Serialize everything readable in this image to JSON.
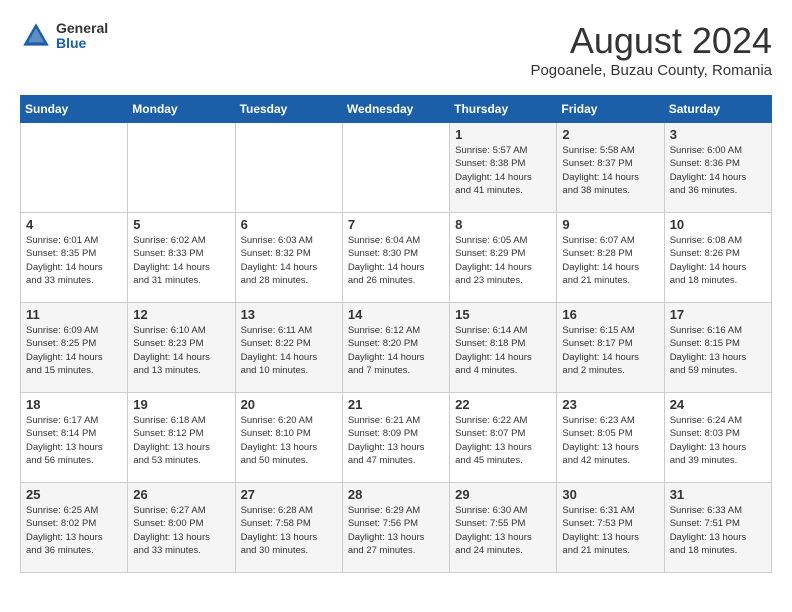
{
  "logo": {
    "general": "General",
    "blue": "Blue"
  },
  "title": "August 2024",
  "subtitle": "Pogoanele, Buzau County, Romania",
  "days_of_week": [
    "Sunday",
    "Monday",
    "Tuesday",
    "Wednesday",
    "Thursday",
    "Friday",
    "Saturday"
  ],
  "weeks": [
    [
      {
        "day": "",
        "info": ""
      },
      {
        "day": "",
        "info": ""
      },
      {
        "day": "",
        "info": ""
      },
      {
        "day": "",
        "info": ""
      },
      {
        "day": "1",
        "info": "Sunrise: 5:57 AM\nSunset: 8:38 PM\nDaylight: 14 hours\nand 41 minutes."
      },
      {
        "day": "2",
        "info": "Sunrise: 5:58 AM\nSunset: 8:37 PM\nDaylight: 14 hours\nand 38 minutes."
      },
      {
        "day": "3",
        "info": "Sunrise: 6:00 AM\nSunset: 8:36 PM\nDaylight: 14 hours\nand 36 minutes."
      }
    ],
    [
      {
        "day": "4",
        "info": "Sunrise: 6:01 AM\nSunset: 8:35 PM\nDaylight: 14 hours\nand 33 minutes."
      },
      {
        "day": "5",
        "info": "Sunrise: 6:02 AM\nSunset: 8:33 PM\nDaylight: 14 hours\nand 31 minutes."
      },
      {
        "day": "6",
        "info": "Sunrise: 6:03 AM\nSunset: 8:32 PM\nDaylight: 14 hours\nand 28 minutes."
      },
      {
        "day": "7",
        "info": "Sunrise: 6:04 AM\nSunset: 8:30 PM\nDaylight: 14 hours\nand 26 minutes."
      },
      {
        "day": "8",
        "info": "Sunrise: 6:05 AM\nSunset: 8:29 PM\nDaylight: 14 hours\nand 23 minutes."
      },
      {
        "day": "9",
        "info": "Sunrise: 6:07 AM\nSunset: 8:28 PM\nDaylight: 14 hours\nand 21 minutes."
      },
      {
        "day": "10",
        "info": "Sunrise: 6:08 AM\nSunset: 8:26 PM\nDaylight: 14 hours\nand 18 minutes."
      }
    ],
    [
      {
        "day": "11",
        "info": "Sunrise: 6:09 AM\nSunset: 8:25 PM\nDaylight: 14 hours\nand 15 minutes."
      },
      {
        "day": "12",
        "info": "Sunrise: 6:10 AM\nSunset: 8:23 PM\nDaylight: 14 hours\nand 13 minutes."
      },
      {
        "day": "13",
        "info": "Sunrise: 6:11 AM\nSunset: 8:22 PM\nDaylight: 14 hours\nand 10 minutes."
      },
      {
        "day": "14",
        "info": "Sunrise: 6:12 AM\nSunset: 8:20 PM\nDaylight: 14 hours\nand 7 minutes."
      },
      {
        "day": "15",
        "info": "Sunrise: 6:14 AM\nSunset: 8:18 PM\nDaylight: 14 hours\nand 4 minutes."
      },
      {
        "day": "16",
        "info": "Sunrise: 6:15 AM\nSunset: 8:17 PM\nDaylight: 14 hours\nand 2 minutes."
      },
      {
        "day": "17",
        "info": "Sunrise: 6:16 AM\nSunset: 8:15 PM\nDaylight: 13 hours\nand 59 minutes."
      }
    ],
    [
      {
        "day": "18",
        "info": "Sunrise: 6:17 AM\nSunset: 8:14 PM\nDaylight: 13 hours\nand 56 minutes."
      },
      {
        "day": "19",
        "info": "Sunrise: 6:18 AM\nSunset: 8:12 PM\nDaylight: 13 hours\nand 53 minutes."
      },
      {
        "day": "20",
        "info": "Sunrise: 6:20 AM\nSunset: 8:10 PM\nDaylight: 13 hours\nand 50 minutes."
      },
      {
        "day": "21",
        "info": "Sunrise: 6:21 AM\nSunset: 8:09 PM\nDaylight: 13 hours\nand 47 minutes."
      },
      {
        "day": "22",
        "info": "Sunrise: 6:22 AM\nSunset: 8:07 PM\nDaylight: 13 hours\nand 45 minutes."
      },
      {
        "day": "23",
        "info": "Sunrise: 6:23 AM\nSunset: 8:05 PM\nDaylight: 13 hours\nand 42 minutes."
      },
      {
        "day": "24",
        "info": "Sunrise: 6:24 AM\nSunset: 8:03 PM\nDaylight: 13 hours\nand 39 minutes."
      }
    ],
    [
      {
        "day": "25",
        "info": "Sunrise: 6:25 AM\nSunset: 8:02 PM\nDaylight: 13 hours\nand 36 minutes."
      },
      {
        "day": "26",
        "info": "Sunrise: 6:27 AM\nSunset: 8:00 PM\nDaylight: 13 hours\nand 33 minutes."
      },
      {
        "day": "27",
        "info": "Sunrise: 6:28 AM\nSunset: 7:58 PM\nDaylight: 13 hours\nand 30 minutes."
      },
      {
        "day": "28",
        "info": "Sunrise: 6:29 AM\nSunset: 7:56 PM\nDaylight: 13 hours\nand 27 minutes."
      },
      {
        "day": "29",
        "info": "Sunrise: 6:30 AM\nSunset: 7:55 PM\nDaylight: 13 hours\nand 24 minutes."
      },
      {
        "day": "30",
        "info": "Sunrise: 6:31 AM\nSunset: 7:53 PM\nDaylight: 13 hours\nand 21 minutes."
      },
      {
        "day": "31",
        "info": "Sunrise: 6:33 AM\nSunset: 7:51 PM\nDaylight: 13 hours\nand 18 minutes."
      }
    ]
  ]
}
